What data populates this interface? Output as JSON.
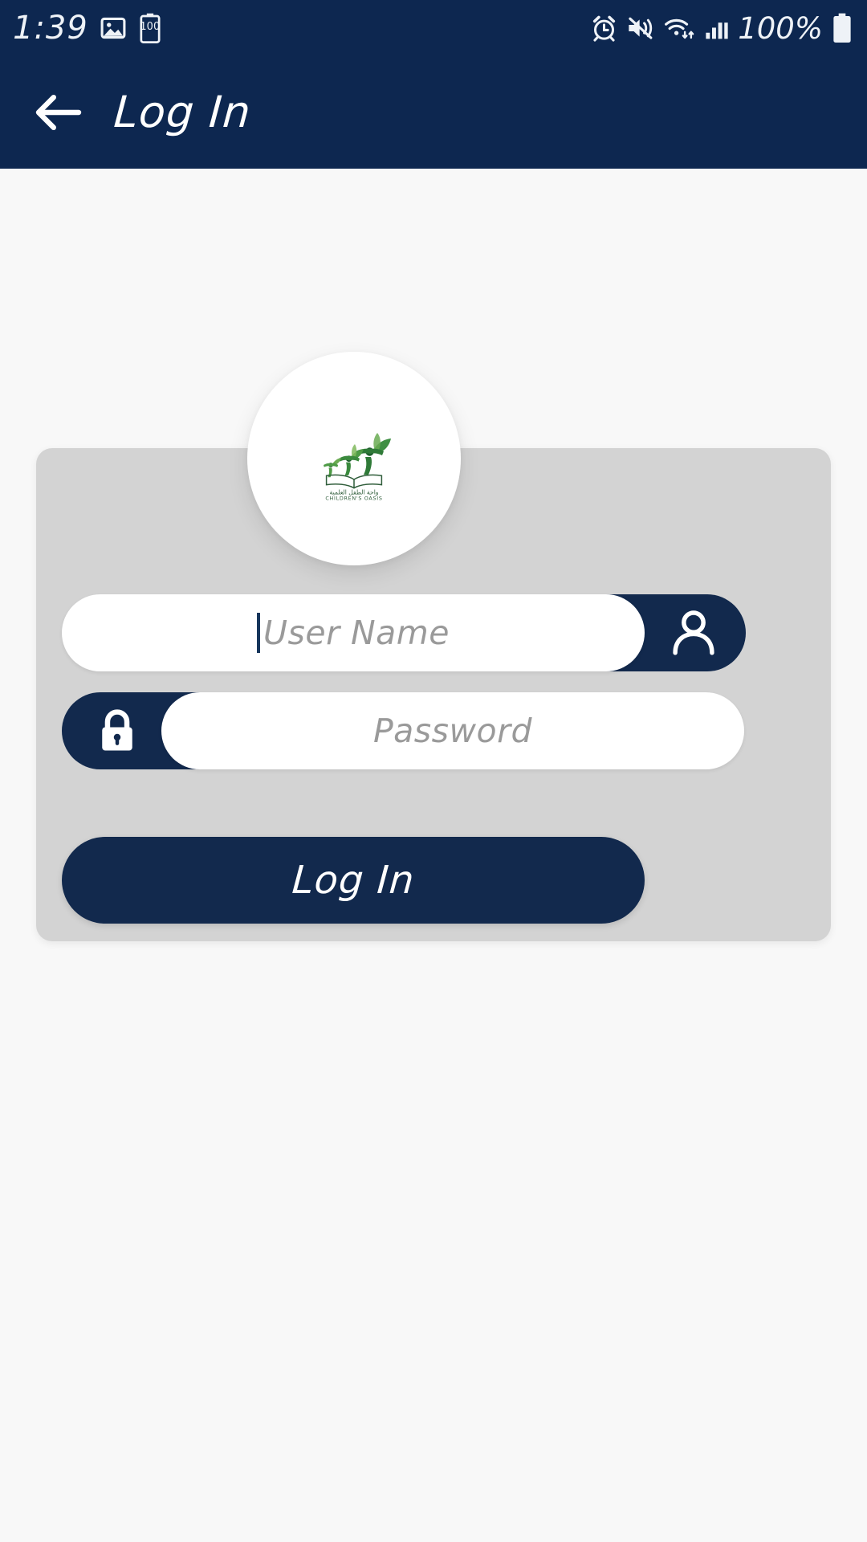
{
  "status_bar": {
    "time": "1:39",
    "battery_badge_text": "100",
    "battery_percent_text": "100%",
    "left_icons": [
      "photo-icon",
      "battery-saver-100-icon"
    ],
    "right_icons": [
      "alarm-icon",
      "vibrate-mute-icon",
      "wifi-icon",
      "signal-bars-icon",
      "battery-icon"
    ],
    "background_color": "#0d2750"
  },
  "app_bar": {
    "back_icon": "back-arrow-icon",
    "title": "Log In",
    "background_color": "#0d2750",
    "title_color": "#ffffff"
  },
  "logo": {
    "icon_name": "childrens-oasis-logo",
    "arabic_text": "واحة الطفل العلمية",
    "latin_text": "CHILDREN'S OASIS",
    "primary_color": "#2e7d3a",
    "accent_color": "#7cb342",
    "book_color": "#2f5d3a"
  },
  "card": {
    "background_color": "#d3d3d3"
  },
  "form": {
    "username": {
      "placeholder": "User Name",
      "value": "",
      "icon_name": "person-icon",
      "icon_side": "right",
      "cursor_visible": true
    },
    "password": {
      "placeholder": "Password",
      "value": "",
      "icon_name": "lock-icon",
      "icon_side": "left"
    },
    "submit": {
      "label": "Log In",
      "background_color": "#12294d",
      "text_color": "#ffffff"
    }
  },
  "theme": {
    "navy": "#0d2750",
    "field_navy": "#12294d",
    "page_background": "#f8f8f8",
    "placeholder_color": "#9a9a9a"
  }
}
